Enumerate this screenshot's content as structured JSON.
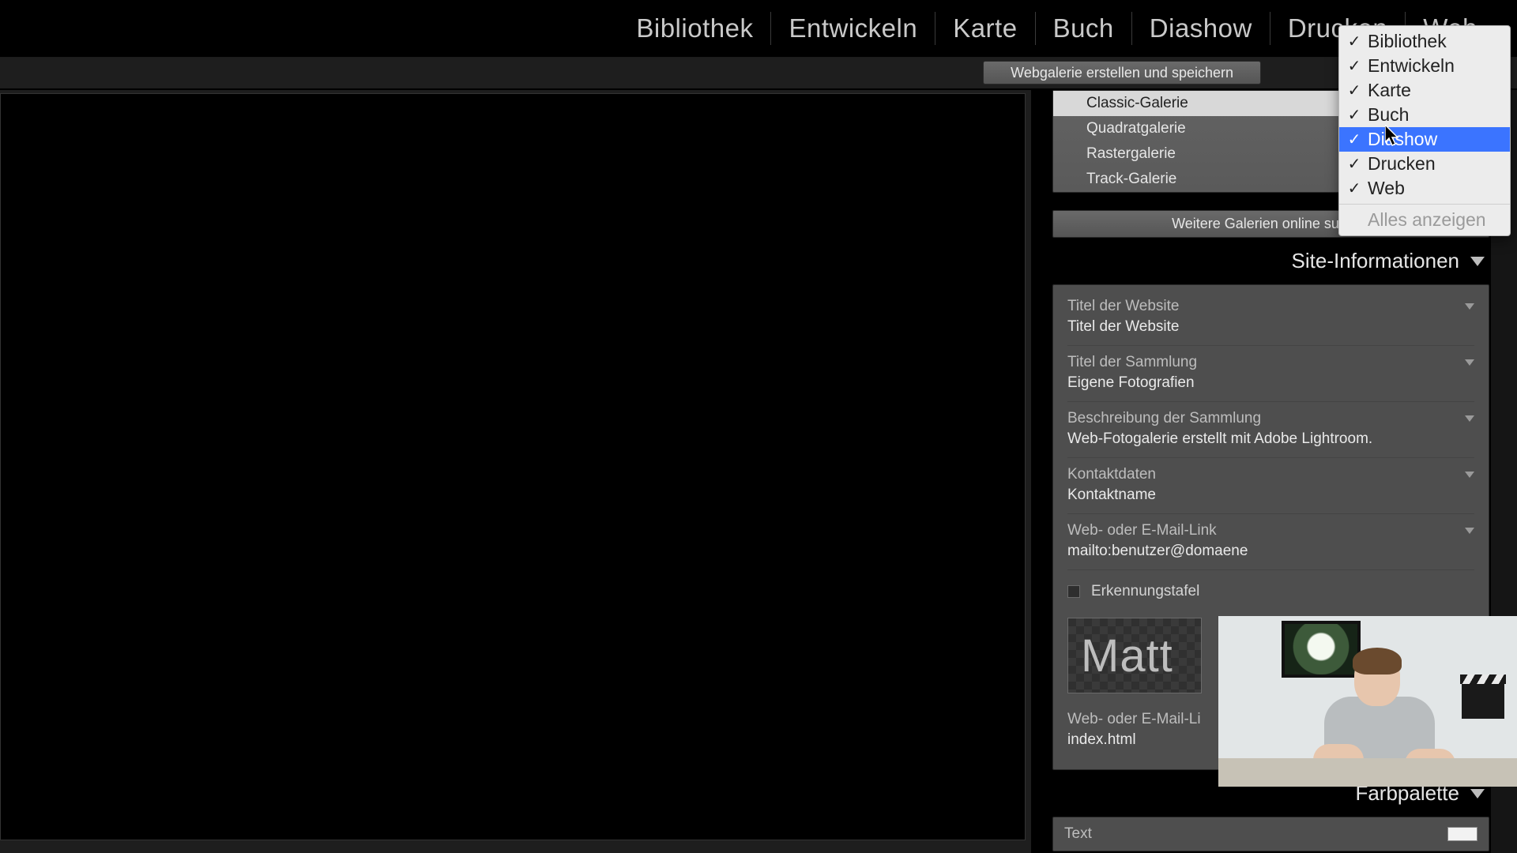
{
  "modules": {
    "library": "Bibliothek",
    "develop": "Entwickeln",
    "map": "Karte",
    "book": "Buch",
    "slideshow": "Diashow",
    "print": "Drucken",
    "web": "Web"
  },
  "toolbar": {
    "create_save": "Webgalerie erstellen und speichern"
  },
  "galleries": {
    "items": [
      "Classic-Galerie",
      "Quadratgalerie",
      "Rastergalerie",
      "Track-Galerie"
    ],
    "more": "Weitere Galerien online suchen"
  },
  "panels": {
    "site_info": {
      "title": "Site-Informationen",
      "fields": {
        "site_title": {
          "label": "Titel der Website",
          "value": "Titel der Website"
        },
        "coll_title": {
          "label": "Titel der Sammlung",
          "value": "Eigene Fotografien"
        },
        "coll_desc": {
          "label": "Beschreibung der Sammlung",
          "value": "Web-Fotogalerie erstellt mit Adobe Lightroom."
        },
        "contact": {
          "label": "Kontaktdaten",
          "value": "Kontaktname"
        },
        "link": {
          "label": "Web- oder E-Mail-Link",
          "value": "mailto:benutzer@domaene"
        }
      },
      "identity_plate": {
        "checkbox_label": "Erkennungstafel",
        "text": "Matt"
      },
      "link2": {
        "label": "Web- oder E-Mail-Li",
        "value": "index.html"
      }
    },
    "color_palette": {
      "title": "Farbpalette",
      "text_label": "Text"
    }
  },
  "context_menu": {
    "items": [
      {
        "label": "Bibliothek",
        "checked": true
      },
      {
        "label": "Entwickeln",
        "checked": true
      },
      {
        "label": "Karte",
        "checked": true
      },
      {
        "label": "Buch",
        "checked": true
      },
      {
        "label": "Diashow",
        "checked": true,
        "hover": true
      },
      {
        "label": "Drucken",
        "checked": true
      },
      {
        "label": "Web",
        "checked": true
      }
    ],
    "show_all": "Alles anzeigen"
  }
}
